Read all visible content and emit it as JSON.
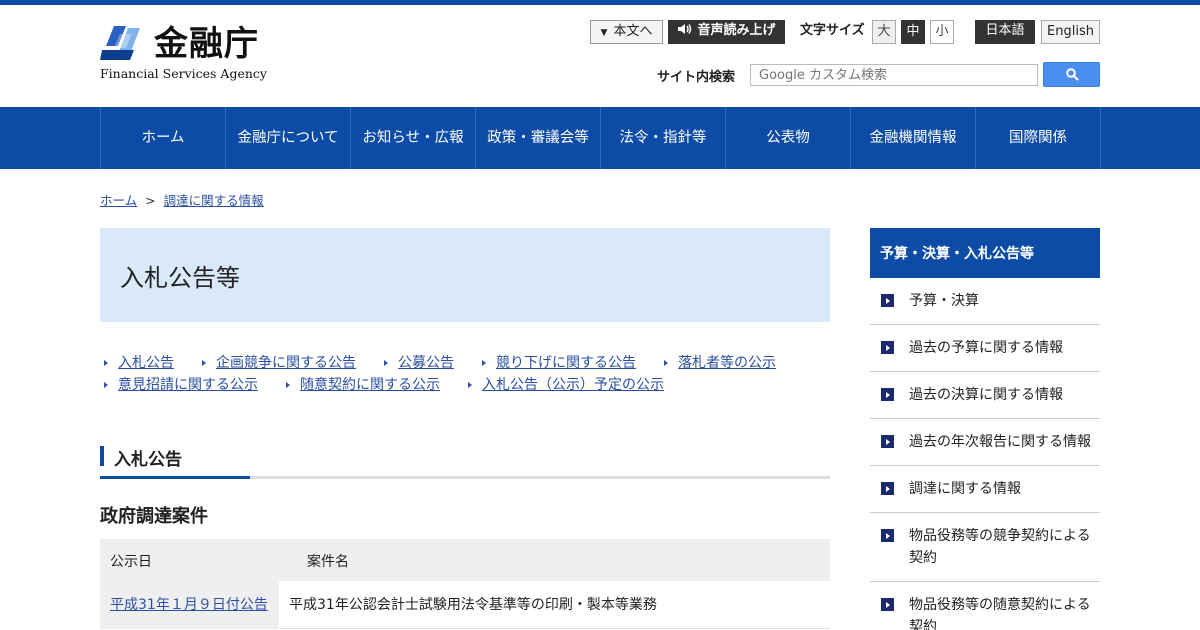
{
  "header": {
    "logo_jp": "金融庁",
    "logo_en": "Financial Services Agency",
    "skip_label": "本文へ",
    "voice_label": "音声読み上げ",
    "font_size_label": "文字サイズ",
    "font_sizes": [
      "大",
      "中",
      "小"
    ],
    "lang_ja": "日本語",
    "lang_en": "English",
    "search_label": "サイト内検索",
    "search_placeholder": "Google カスタム検索"
  },
  "nav": {
    "items": [
      "ホーム",
      "金融庁について",
      "お知らせ・広報",
      "政策・審議会等",
      "法令・指針等",
      "公表物",
      "金融機関情報",
      "国際関係"
    ]
  },
  "breadcrumb": {
    "home": "ホーム",
    "sep": ">",
    "current": "調達に関する情報"
  },
  "main": {
    "title": "入札公告等",
    "links": [
      "入札公告",
      "企画競争に関する公告",
      "公募公告",
      "競り下げに関する公告",
      "落札者等の公示",
      "意見招請に関する公示",
      "随意契約に関する公示",
      "入札公告（公示）予定の公示"
    ],
    "section_heading": "入札公告",
    "sub_heading": "政府調達案件",
    "table": {
      "headers": [
        "公示日",
        "案件名"
      ],
      "rows": [
        {
          "date": "平成31年１月９日付公告",
          "name": "平成31年公認会計士試験用法令基準等の印刷・製本等業務"
        }
      ]
    }
  },
  "sidebar": {
    "heading": "予算・決算・入札公告等",
    "items": [
      "予算・決算",
      "過去の予算に関する情報",
      "過去の決算に関する情報",
      "過去の年次報告に関する情報",
      "調達に関する情報",
      "物品役務等の競争契約による契約",
      "物品役務等の随意契約による契約"
    ]
  },
  "colors": {
    "brand_blue": "#0c4ca6",
    "light_blue": "#d9e9f9",
    "link": "#2b4fa3"
  }
}
